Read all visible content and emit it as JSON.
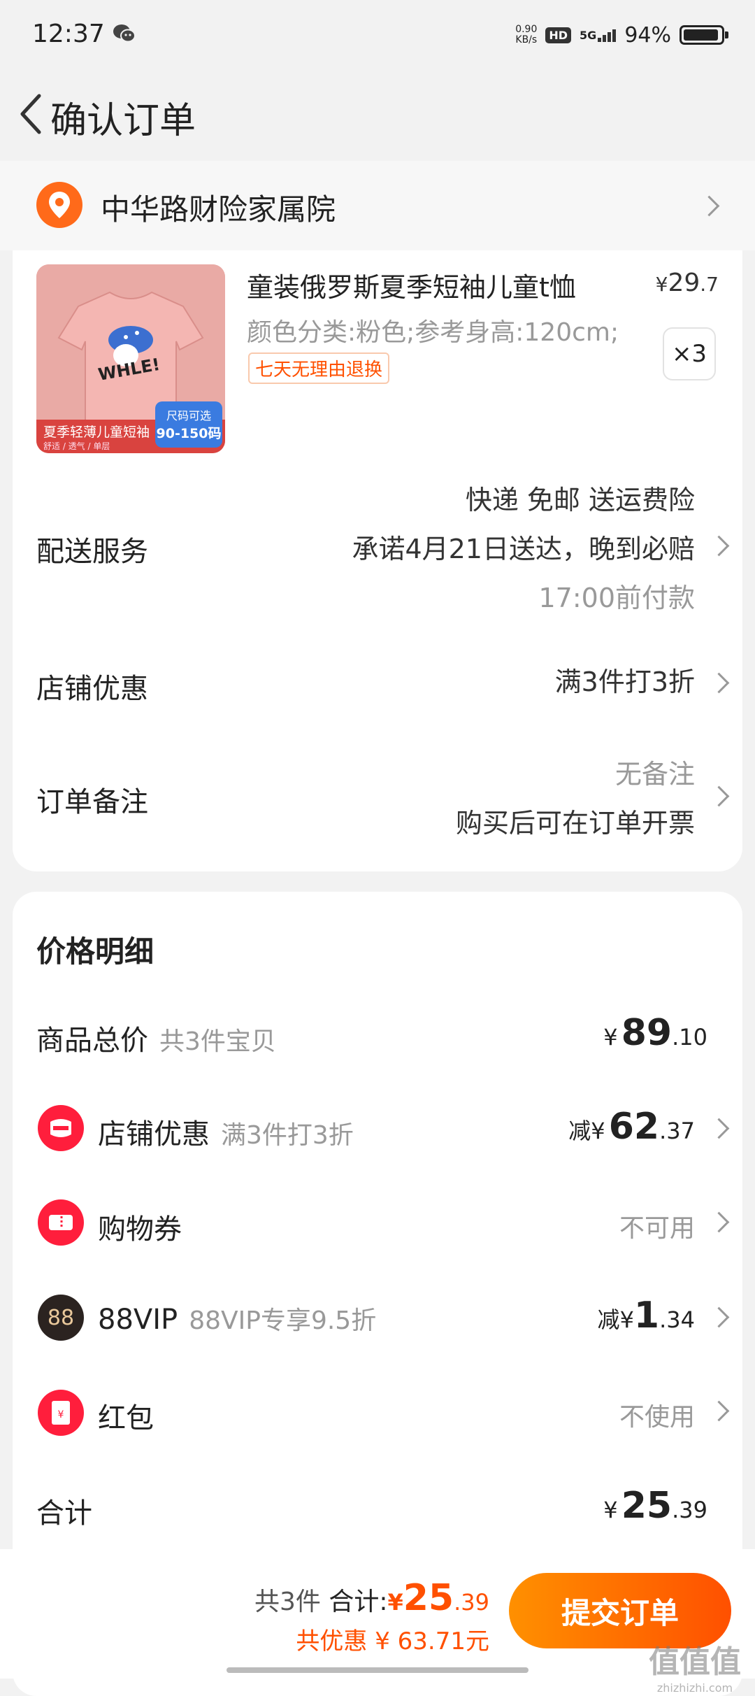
{
  "status": {
    "time": "12:37",
    "speed_value": "0.90",
    "speed_unit": "KB/s",
    "hd": "HD",
    "network": "5G",
    "battery": "94%",
    "battery_level": 0.94
  },
  "nav": {
    "title": "确认订单"
  },
  "address": {
    "name": "中华路财险家属院"
  },
  "product": {
    "title": "童装俄罗斯夏季短袖儿童t恤",
    "price_symbol": "¥",
    "price_int": "29",
    "price_dec": ".7",
    "spec": "颜色分类:粉色;参考身高:120cm;",
    "tag": "七天无理由退换",
    "qty": "×3",
    "img_caption": "夏季轻薄儿童短袖",
    "img_sub": "舒适 / 透气 / 单层",
    "img_badge_top": "尺码可选",
    "img_badge_bottom": "90-150码",
    "img_shirt_text": "WHLE!"
  },
  "delivery": {
    "label": "配送服务",
    "line1": "快递 免邮 送运费险",
    "line2": "承诺4月21日送达，晚到必赔",
    "line3": "17:00前付款"
  },
  "store_discount": {
    "label": "店铺优惠",
    "value": "满3件打3折"
  },
  "remark": {
    "label": "订单备注",
    "line1": "无备注",
    "line2": "购买后可在订单开票"
  },
  "price_detail": {
    "title": "价格明细",
    "goods_total": {
      "label": "商品总价",
      "sub": "共3件宝贝",
      "symbol": "¥",
      "int": "89",
      "dec": ".10"
    },
    "store": {
      "label": "店铺优惠",
      "sub": "满3件打3折",
      "prefix": "减",
      "symbol": "¥",
      "int": "62",
      "dec": ".37"
    },
    "coupon": {
      "label": "购物券",
      "value": "不可用"
    },
    "vip": {
      "icon_text": "88",
      "label": "88VIP",
      "sub": "88VIP专享9.5折",
      "prefix": "减",
      "symbol": "¥",
      "int": "1",
      "dec": ".34"
    },
    "redpacket": {
      "label": "红包",
      "value": "不使用",
      "icon_text": "¥"
    },
    "total": {
      "label": "合计",
      "symbol": "¥",
      "int": "25",
      "dec": ".39"
    }
  },
  "bottom": {
    "count": "共3件",
    "total_label": "合计:",
    "symbol": "¥",
    "int": "25",
    "dec": ".39",
    "saved": "共优惠 ¥ 63.71元",
    "submit": "提交订单",
    "watermark": "值值值",
    "watermark_url": "zhizhizhi.com"
  },
  "colors": {
    "accent": "#ff5000",
    "accent2": "#ff9000",
    "red_icon": "#ff1e3c"
  }
}
